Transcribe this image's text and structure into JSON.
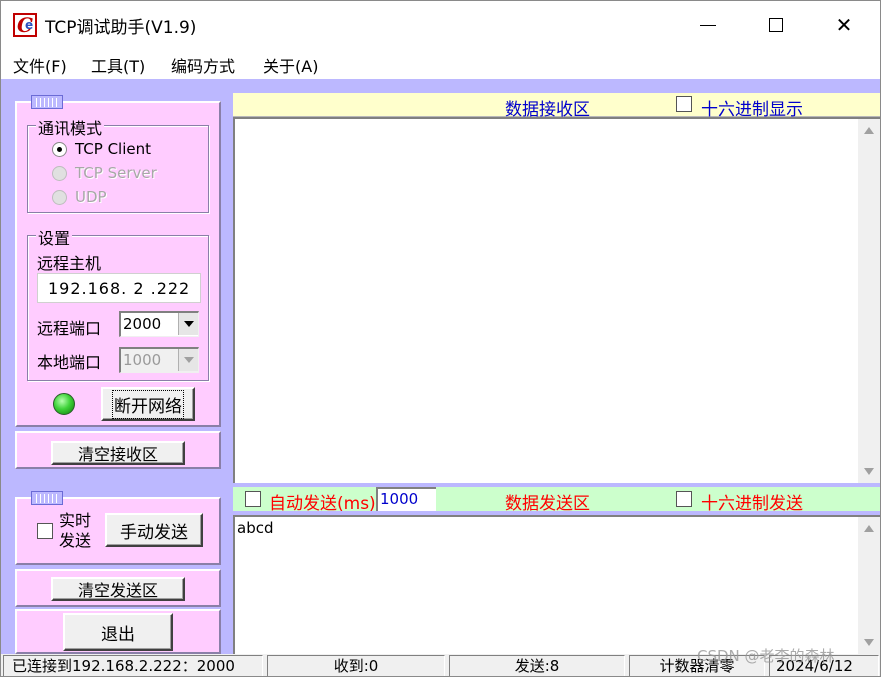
{
  "window": {
    "title": "TCP调试助手(V1.9)",
    "icon": "app-logo-icon",
    "controls": {
      "minimize": "minimize-icon",
      "maximize": "maximize-icon",
      "close": "close-icon",
      "close_glyph": "✕"
    }
  },
  "menu": [
    "文件(F)",
    "工具(T)",
    "编码方式",
    "关于(A)"
  ],
  "connection": {
    "mode_title": "通讯模式",
    "modes": [
      {
        "label": "TCP Client",
        "selected": true,
        "enabled": true
      },
      {
        "label": "TCP Server",
        "selected": false,
        "enabled": false
      },
      {
        "label": "UDP",
        "selected": false,
        "enabled": false
      }
    ],
    "settings_title": "设置",
    "remote_host_label": "远程主机",
    "remote_host_value": "192.168. 2 .222",
    "remote_port_label": "远程端口",
    "remote_port_value": "2000",
    "local_port_label": "本地端口",
    "local_port_value": "1000",
    "status_led": "green",
    "disconnect_label": "断开网络",
    "clear_receive_label": "清空接收区"
  },
  "send_panel": {
    "realtime_label_1": "实时",
    "realtime_label_2": "发送",
    "manual_send_label": "手动发送",
    "clear_send_label": "清空发送区",
    "exit_label": "退出"
  },
  "receive_area": {
    "title": "数据接收区",
    "hex_display_label": "十六进制显示",
    "content": ""
  },
  "send_area": {
    "auto_send_label": "自动发送(ms)",
    "interval_value": "1000",
    "title": "数据发送区",
    "hex_send_label": "十六进制发送",
    "content": "abcd"
  },
  "statusbar": {
    "connection": "已连接到192.168.2.222：2000",
    "received": "收到:0",
    "sent": "发送:8",
    "reset_counter": "计数器清零",
    "date": "2024/6/12"
  },
  "watermark": "CSDN @老李的森林",
  "colors": {
    "client_bg": "#bcb8ff",
    "panel_bg": "#ffccff",
    "recv_header_bg": "#ffffcc",
    "send_header_bg": "#ccffcc",
    "title_blue": "#0000cc",
    "send_red": "#ff0000",
    "led_green": "#3fd33a"
  }
}
